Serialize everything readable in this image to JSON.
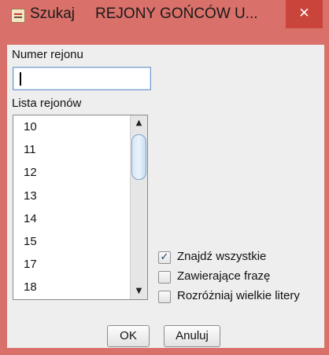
{
  "window": {
    "app_name": "Szukaj",
    "title": "REJONY GOŃCÓW U...",
    "close_symbol": "✕"
  },
  "region_number": {
    "label": "Numer rejonu",
    "value": ""
  },
  "region_list": {
    "label": "Lista rejonów",
    "items": [
      "10",
      "11",
      "12",
      "13",
      "14",
      "15",
      "17",
      "18"
    ],
    "scroll_up_symbol": "▲",
    "scroll_down_symbol": "▼"
  },
  "options": [
    {
      "label": "Znajdź wszystkie",
      "checked": true,
      "mark": "✓"
    },
    {
      "label": "Zawierające frazę",
      "checked": false,
      "mark": ""
    },
    {
      "label": "Rozróżniaj wielkie litery",
      "checked": false,
      "mark": ""
    }
  ],
  "buttons": {
    "ok": "OK",
    "cancel": "Anuluj"
  },
  "colors": {
    "frame": "#d9706a",
    "close_button": "#c9443b",
    "content_background": "#eeeeee"
  },
  "icons": {
    "title": "java-app-icon",
    "close": "close-icon",
    "check": "checkmark-icon"
  }
}
